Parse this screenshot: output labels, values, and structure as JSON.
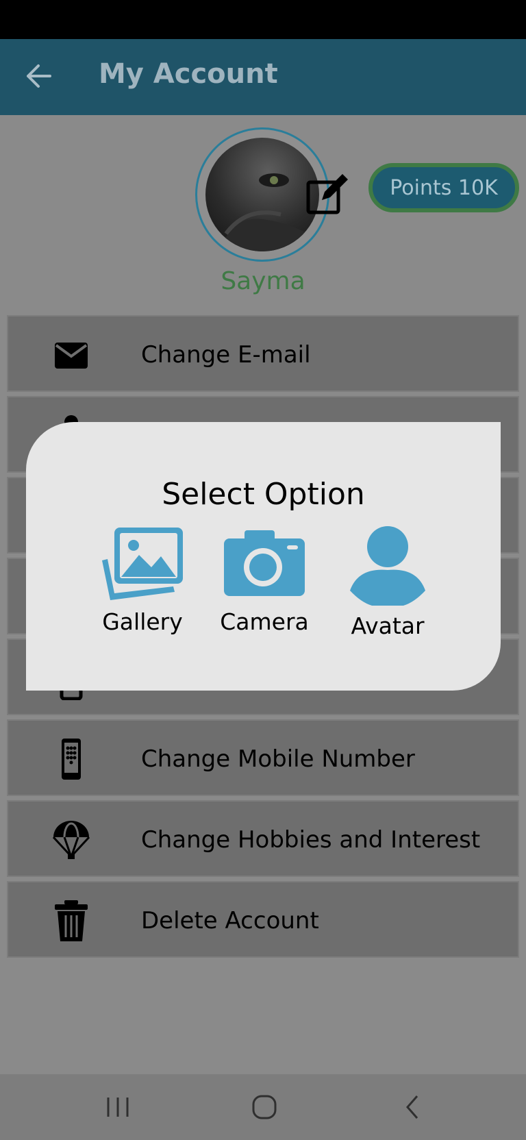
{
  "app_bar": {
    "title": "My Account",
    "back_icon": "arrow-left-icon"
  },
  "profile": {
    "name": "Sayma",
    "points_label": "Points 10K",
    "edit_icon": "edit-icon"
  },
  "menu": [
    {
      "label": "Change E-mail",
      "icon": "mail-icon"
    },
    {
      "label": "",
      "icon": "hidden-icon"
    },
    {
      "label": "",
      "icon": "hidden-icon"
    },
    {
      "label": "",
      "icon": "hidden-icon"
    },
    {
      "label": "",
      "icon": "hidden-icon"
    },
    {
      "label": "Change Mobile Number",
      "icon": "mobile-phone-icon"
    },
    {
      "label": "Change Hobbies and Interest",
      "icon": "parachute-icon"
    },
    {
      "label": "Delete Account",
      "icon": "trash-icon"
    }
  ],
  "dialog": {
    "title": "Select Option",
    "options": [
      {
        "label": "Gallery",
        "icon": "gallery-icon"
      },
      {
        "label": "Camera",
        "icon": "camera-icon"
      },
      {
        "label": "Avatar",
        "icon": "person-icon"
      }
    ],
    "accent": "#4aa0c8"
  },
  "nav": {
    "recents": "recents-icon",
    "home": "home-icon",
    "back": "back-icon"
  }
}
